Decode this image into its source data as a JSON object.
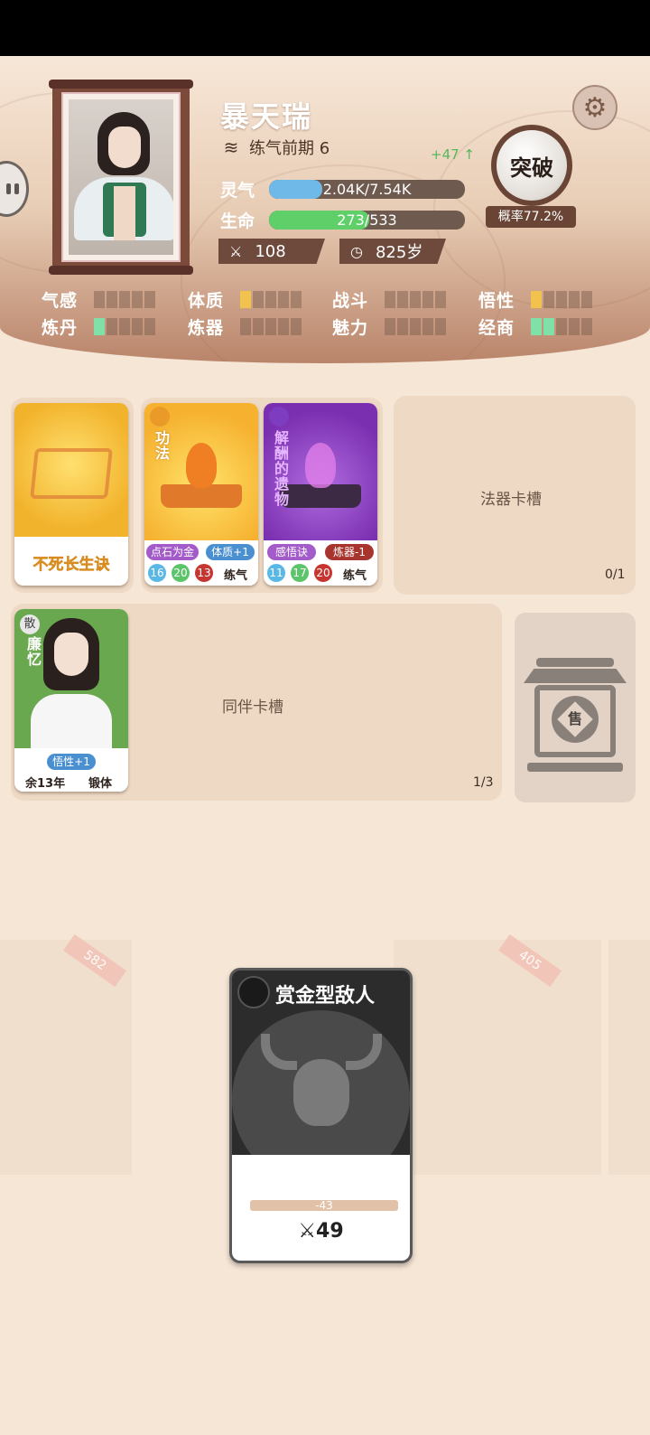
{
  "player": {
    "name": "暴天瑞",
    "realm": "练气前期 6",
    "gain": "+47 ↑",
    "qi_label": "灵气",
    "qi_text": "2.04K/7.54K",
    "qi_fraction": 0.27,
    "hp_label": "生命",
    "hp_text": "273/533",
    "hp_fraction": 0.51,
    "power": "108",
    "age": "825岁"
  },
  "breakthrough": {
    "label": "突破",
    "probability": "概率77.2%"
  },
  "attributes": [
    {
      "label": "气感",
      "level": 0,
      "color": "#f2c24f"
    },
    {
      "label": "体质",
      "level": 1,
      "color": "#f2c24f"
    },
    {
      "label": "战斗",
      "level": 0,
      "color": "#f2c24f"
    },
    {
      "label": "悟性",
      "level": 1,
      "color": "#f2c24f"
    },
    {
      "label": "炼丹",
      "level": 1,
      "color": "#7fe0a8"
    },
    {
      "label": "炼器",
      "level": 0,
      "color": "#7fe0a8"
    },
    {
      "label": "魅力",
      "level": 0,
      "color": "#7fe0a8"
    },
    {
      "label": "经商",
      "level": 2,
      "color": "#7fe0a8"
    }
  ],
  "cards": {
    "main_technique": {
      "title": "不死长生诀"
    },
    "technique": {
      "type": "功法",
      "tags": [
        "点石为金",
        "体质+1"
      ],
      "nums": [
        "16",
        "20",
        "13"
      ],
      "rank": "练气"
    },
    "relic": {
      "type": "解酬的遗物",
      "tags": [
        "感悟诀",
        "炼器-1"
      ],
      "nums": [
        "11",
        "17",
        "20"
      ],
      "rank": "练气"
    },
    "companion": {
      "badge": "散",
      "name": "廉忆",
      "tag": "悟性+1",
      "remaining": "余13年",
      "rank": "锻体"
    }
  },
  "slots": {
    "artifact_label": "法器卡槽",
    "artifact_count": "0/1",
    "companion_label": "同伴卡槽",
    "companion_count": "1/3"
  },
  "shop": {
    "glyph": "售"
  },
  "stalls": [
    {
      "price": "582"
    },
    {
      "price": "405"
    }
  ],
  "enemy": {
    "title": "赏金型敌人",
    "delta": "-43",
    "power": "49"
  }
}
